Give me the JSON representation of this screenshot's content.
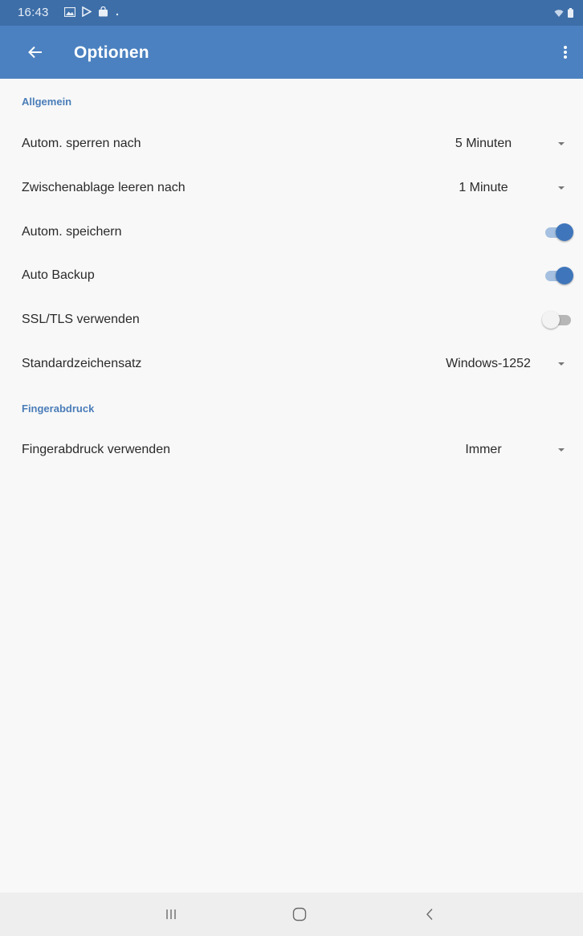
{
  "status_bar": {
    "time": "16:43",
    "left_icons": [
      "gallery-icon",
      "play-store-icon",
      "shopping-bag-icon",
      "dot-icon"
    ],
    "right_icons": [
      "wifi-icon",
      "battery-icon"
    ]
  },
  "app_bar": {
    "title": "Optionen",
    "back_icon": "arrow-back-icon",
    "menu_icon": "more-vert-icon",
    "color": "#4b81c0"
  },
  "sections": {
    "general": {
      "title": "Allgemein",
      "lock_after": {
        "label": "Autom. sperren nach",
        "value": "5 Minuten"
      },
      "clear_clipboard": {
        "label": "Zwischenablage leeren nach",
        "value": "1 Minute"
      },
      "autosave": {
        "label": "Autom. speichern",
        "enabled": true
      },
      "auto_backup": {
        "label": "Auto Backup",
        "enabled": true
      },
      "ssl_tls": {
        "label": "SSL/TLS verwenden",
        "enabled": false
      },
      "charset": {
        "label": "Standardzeichensatz",
        "value": "Windows-1252"
      }
    },
    "fingerprint": {
      "title": "Fingerabdruck",
      "use_fingerprint": {
        "label": "Fingerabdruck verwenden",
        "value": "Immer"
      }
    }
  },
  "nav_bar": {
    "buttons": [
      "recent-apps-icon",
      "home-icon",
      "back-icon"
    ]
  },
  "colors": {
    "accent": "#4a7db8",
    "switch_on": "#3f76bb"
  }
}
